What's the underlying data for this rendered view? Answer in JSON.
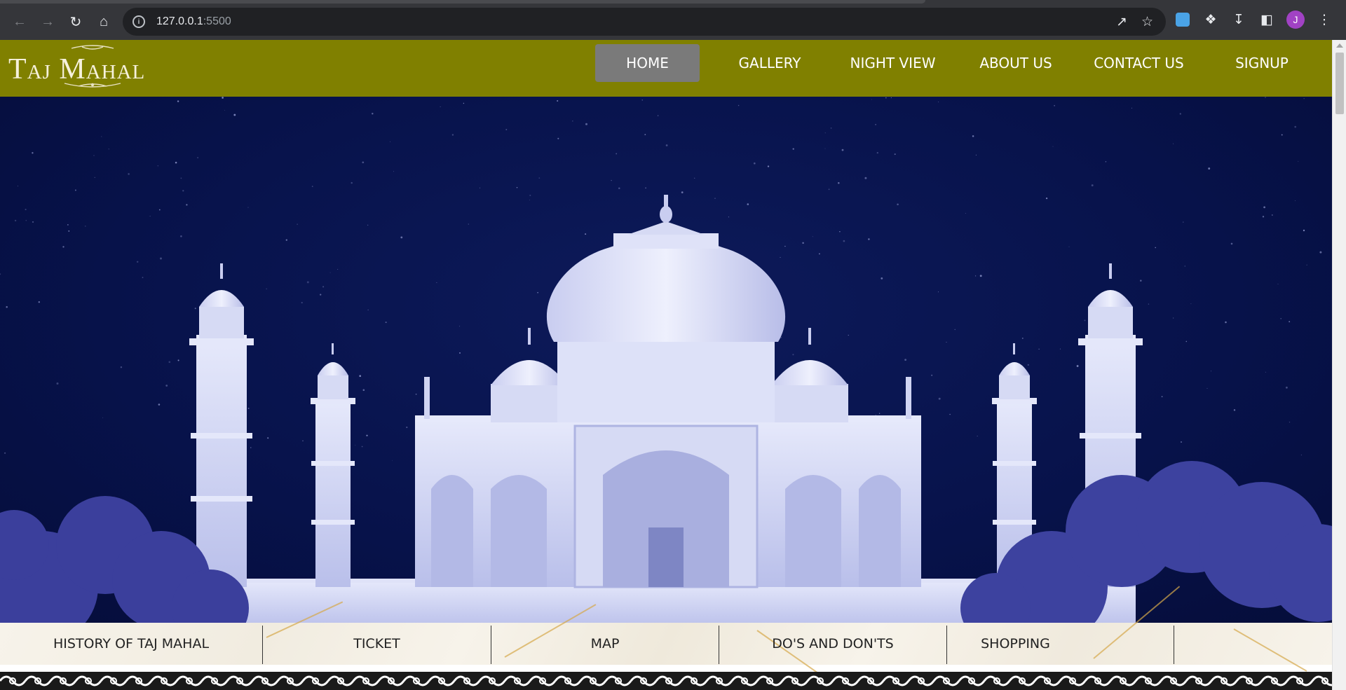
{
  "browser": {
    "url_host": "127.0.0.1",
    "url_port": ":5500",
    "profile_initial": "J"
  },
  "site": {
    "logo_text": "Taj Mahal",
    "nav": [
      {
        "label": "HOME",
        "active": true
      },
      {
        "label": "GALLERY",
        "active": false
      },
      {
        "label": "NIGHT VIEW",
        "active": false
      },
      {
        "label": "ABOUT US",
        "active": false
      },
      {
        "label": "CONTACT US",
        "active": false
      },
      {
        "label": "SIGNUP",
        "active": false
      }
    ],
    "bottom_menu": [
      {
        "label": "HISTORY OF TAJ MAHAL"
      },
      {
        "label": "TICKET"
      },
      {
        "label": "MAP"
      },
      {
        "label": "DO'S AND DON'TS"
      },
      {
        "label": "SHOPPING"
      }
    ]
  },
  "colors": {
    "header_bg": "#808000",
    "nav_active_bg": "#7a7a7a",
    "hero_sky": "#07124a",
    "monument": "#c8cdf0"
  }
}
